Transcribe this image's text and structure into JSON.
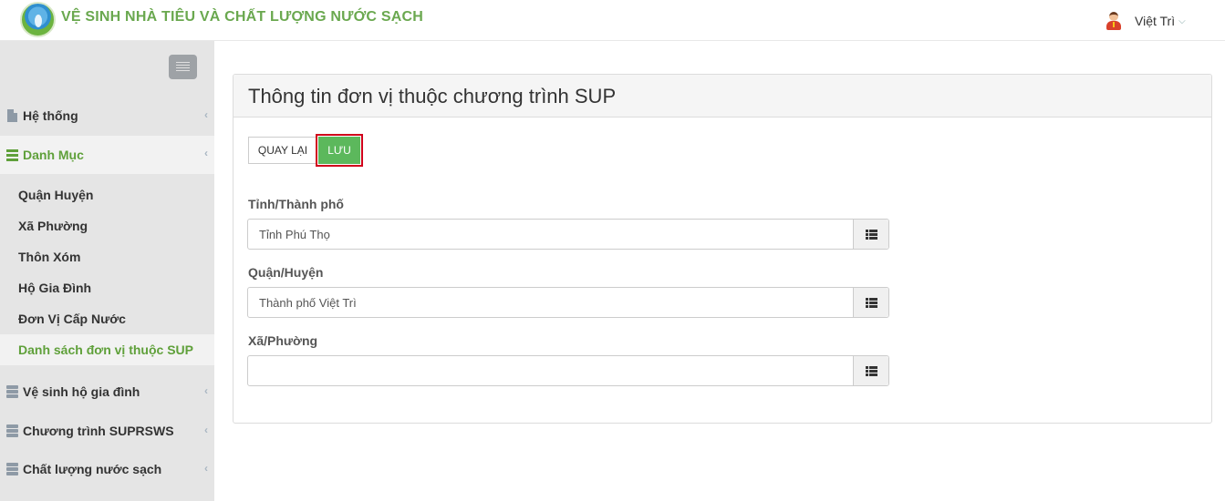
{
  "header": {
    "app_title": "VỆ SINH NHÀ TIÊU VÀ CHẤT LƯỢNG NƯỚC SẠCH",
    "user_name": "Việt Trì",
    "user_caret": "⌵"
  },
  "sidebar": {
    "menu": [
      {
        "label": "Hệ thống",
        "icon": "document-icon",
        "chevron": "‹"
      },
      {
        "label": "Danh Mục",
        "icon": "bars-icon",
        "chevron": "‹"
      },
      {
        "label": "Vệ sinh hộ gia đình",
        "icon": "server-icon",
        "chevron": "‹"
      },
      {
        "label": "Chương trình SUPRSWS",
        "icon": "server-icon",
        "chevron": "‹"
      },
      {
        "label": "Chất lượng nước sạch",
        "icon": "server-icon",
        "chevron": "‹"
      }
    ],
    "submenu": [
      {
        "label": "Quận Huyện"
      },
      {
        "label": "Xã Phường"
      },
      {
        "label": "Thôn Xóm"
      },
      {
        "label": "Hộ Gia Đình"
      },
      {
        "label": "Đơn Vị Cấp Nước"
      },
      {
        "label": "Danh sách đơn vị thuộc SUP"
      }
    ]
  },
  "panel": {
    "title": "Thông tin đơn vị thuộc chương trình SUP",
    "back_label": "QUAY LẠI",
    "save_label": "LƯU",
    "fields": [
      {
        "label": "Tỉnh/Thành phố",
        "value": "Tỉnh Phú Thọ"
      },
      {
        "label": "Quận/Huyện",
        "value": "Thành phố Việt Trì"
      },
      {
        "label": "Xã/Phường",
        "value": ""
      }
    ]
  },
  "colors": {
    "brand_green": "#5fa03a",
    "save_button": "#5cb85c",
    "highlight_border": "#d0021b"
  }
}
